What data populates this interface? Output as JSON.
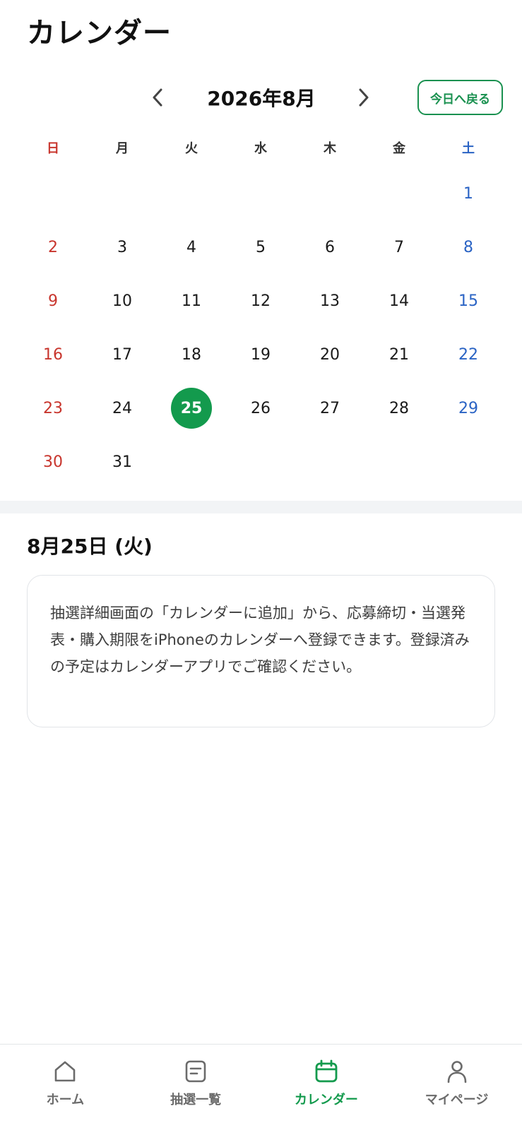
{
  "header": {
    "title": "カレンダー"
  },
  "month_nav": {
    "label": "2026年8月",
    "prev_icon": "chevron-left-icon",
    "next_icon": "chevron-right-icon",
    "today_label": "今日へ戻る",
    "accent_color": "#1a9150"
  },
  "weekdays": [
    "日",
    "月",
    "火",
    "水",
    "木",
    "金",
    "土"
  ],
  "calendar": {
    "leading_blanks": 6,
    "days": [
      "1",
      "2",
      "3",
      "4",
      "5",
      "6",
      "7",
      "8",
      "9",
      "10",
      "11",
      "12",
      "13",
      "14",
      "15",
      "16",
      "17",
      "18",
      "19",
      "20",
      "21",
      "22",
      "23",
      "24",
      "25",
      "26",
      "27",
      "28",
      "29",
      "30",
      "31"
    ],
    "selected_day": "25",
    "sunday_color": "#c8352d",
    "saturday_color": "#2a63c4",
    "selected_color": "#139a4d"
  },
  "selected_date": {
    "label": "8月25日 (火)"
  },
  "info": {
    "text": "抽選詳細画面の「カレンダーに追加」から、応募締切・当選発表・購入期限をiPhoneのカレンダーへ登録できます。登録済みの予定はカレンダーアプリでご確認ください。"
  },
  "tab_bar": {
    "items": [
      {
        "label": "ホーム",
        "icon": "home-icon",
        "active": false
      },
      {
        "label": "抽選一覧",
        "icon": "list-icon",
        "active": false
      },
      {
        "label": "カレンダー",
        "icon": "calendar-icon",
        "active": true
      },
      {
        "label": "マイページ",
        "icon": "person-icon",
        "active": false
      }
    ]
  }
}
